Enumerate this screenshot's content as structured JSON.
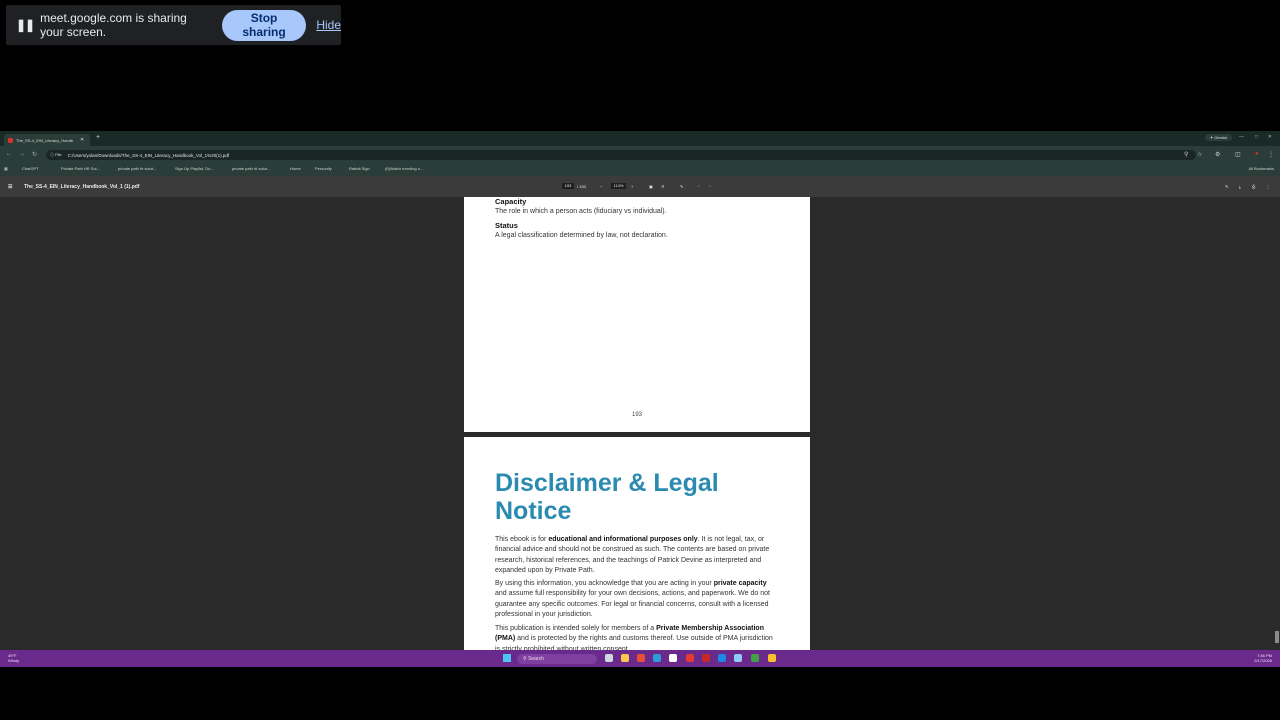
{
  "banner": {
    "message": "meet.google.com is sharing your screen.",
    "stop_label": "Stop sharing",
    "hide_label": "Hide"
  },
  "browser": {
    "tab_title": "The_SS-4_EIN_Literacy_Handb",
    "gemini_label": "Gemini",
    "address_chip": "File",
    "url": "C:/Users/yolan/Downloads/The_SS-4_EIN_Literacy_Handbook_Vol_1%20(1).pdf",
    "bookmarks": [
      "ChatGPT",
      "Private Path HR Sol...",
      "private path ht solut...",
      "Sign Up Playlist, Do...",
      "private path ht solut...",
      "Home",
      "Personify",
      "Rabbit Sign",
      "(6)Watch trending o..."
    ],
    "all_bookmarks": "All Bookmarks"
  },
  "pdf": {
    "filename": "The_SS-4_EIN_Literacy_Handbook_Vol_1 (1).pdf",
    "current_page": "193",
    "total_pages": "/ 193",
    "zoom": "114%",
    "page1": {
      "term1": "Capacity",
      "def1": "The role in which a person acts (fiduciary vs individual).",
      "term2": "Status",
      "def2": "A legal classification determined by law, not declaration.",
      "page_number": "193"
    },
    "page2": {
      "heading_line1": "Disclaimer & Legal",
      "heading_line2": "Notice",
      "p1_a": "This ebook is for ",
      "p1_bold": "educational and informational purposes only",
      "p1_b": ". It is not legal, tax, or financial advice and should not be construed as such. The contents are based on private research, historical references, and the teachings of Patrick Devine as interpreted and expanded upon by Private Path.",
      "p2_a": "By using this information, you acknowledge that you are acting in your ",
      "p2_bold": "private capacity",
      "p2_b": " and assume full responsibility for your own decisions, actions, and paperwork. We do not guarantee any specific outcomes. For legal or financial concerns, consult with a licensed professional in your jurisdiction.",
      "p3_a": "This publication is intended solely for members of a ",
      "p3_bold": "Private Membership Association (PMA)",
      "p3_b": " and is protected by the rights and customs thereof. Use outside of PMA jurisdiction is strictly prohibited without written consent."
    }
  },
  "taskbar": {
    "weather_temp": "49°F",
    "weather_desc": "Windy",
    "search_placeholder": "Search",
    "time": "7:46 PM",
    "date": "2/17/2026"
  },
  "colors": {
    "heading": "#2a8ab0",
    "stop_button": "#a8c7fa",
    "taskbar": "#6a2a8c"
  }
}
